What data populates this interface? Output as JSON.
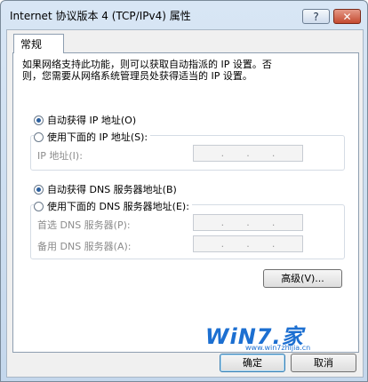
{
  "window": {
    "title": "Internet 协议版本 4 (TCP/IPv4) 属性",
    "help_glyph": "?",
    "close_glyph": "✕"
  },
  "tab": {
    "label": "常规"
  },
  "description_line1": "如果网络支持此功能，则可以获取自动指派的 IP 设置。否",
  "description_line2": "则，您需要从网络系统管理员处获得适当的 IP 设置。",
  "ip": {
    "auto_label": "自动获得 IP 地址(O)",
    "auto_selected": true,
    "manual_label": "使用下面的 IP 地址(S):",
    "address_label": "IP 地址(I):"
  },
  "dns": {
    "auto_label": "自动获得 DNS 服务器地址(B)",
    "auto_selected": true,
    "manual_label": "使用下面的 DNS 服务器地址(E):",
    "preferred_label": "首选 DNS 服务器(P):",
    "alternate_label": "备用 DNS 服务器(A):"
  },
  "advanced_label": "高级(V)...",
  "ok_label": "确定",
  "cancel_label": "取消",
  "watermark": {
    "brand": "WiN7.家",
    "url": "www.win7zhijia.cn"
  }
}
